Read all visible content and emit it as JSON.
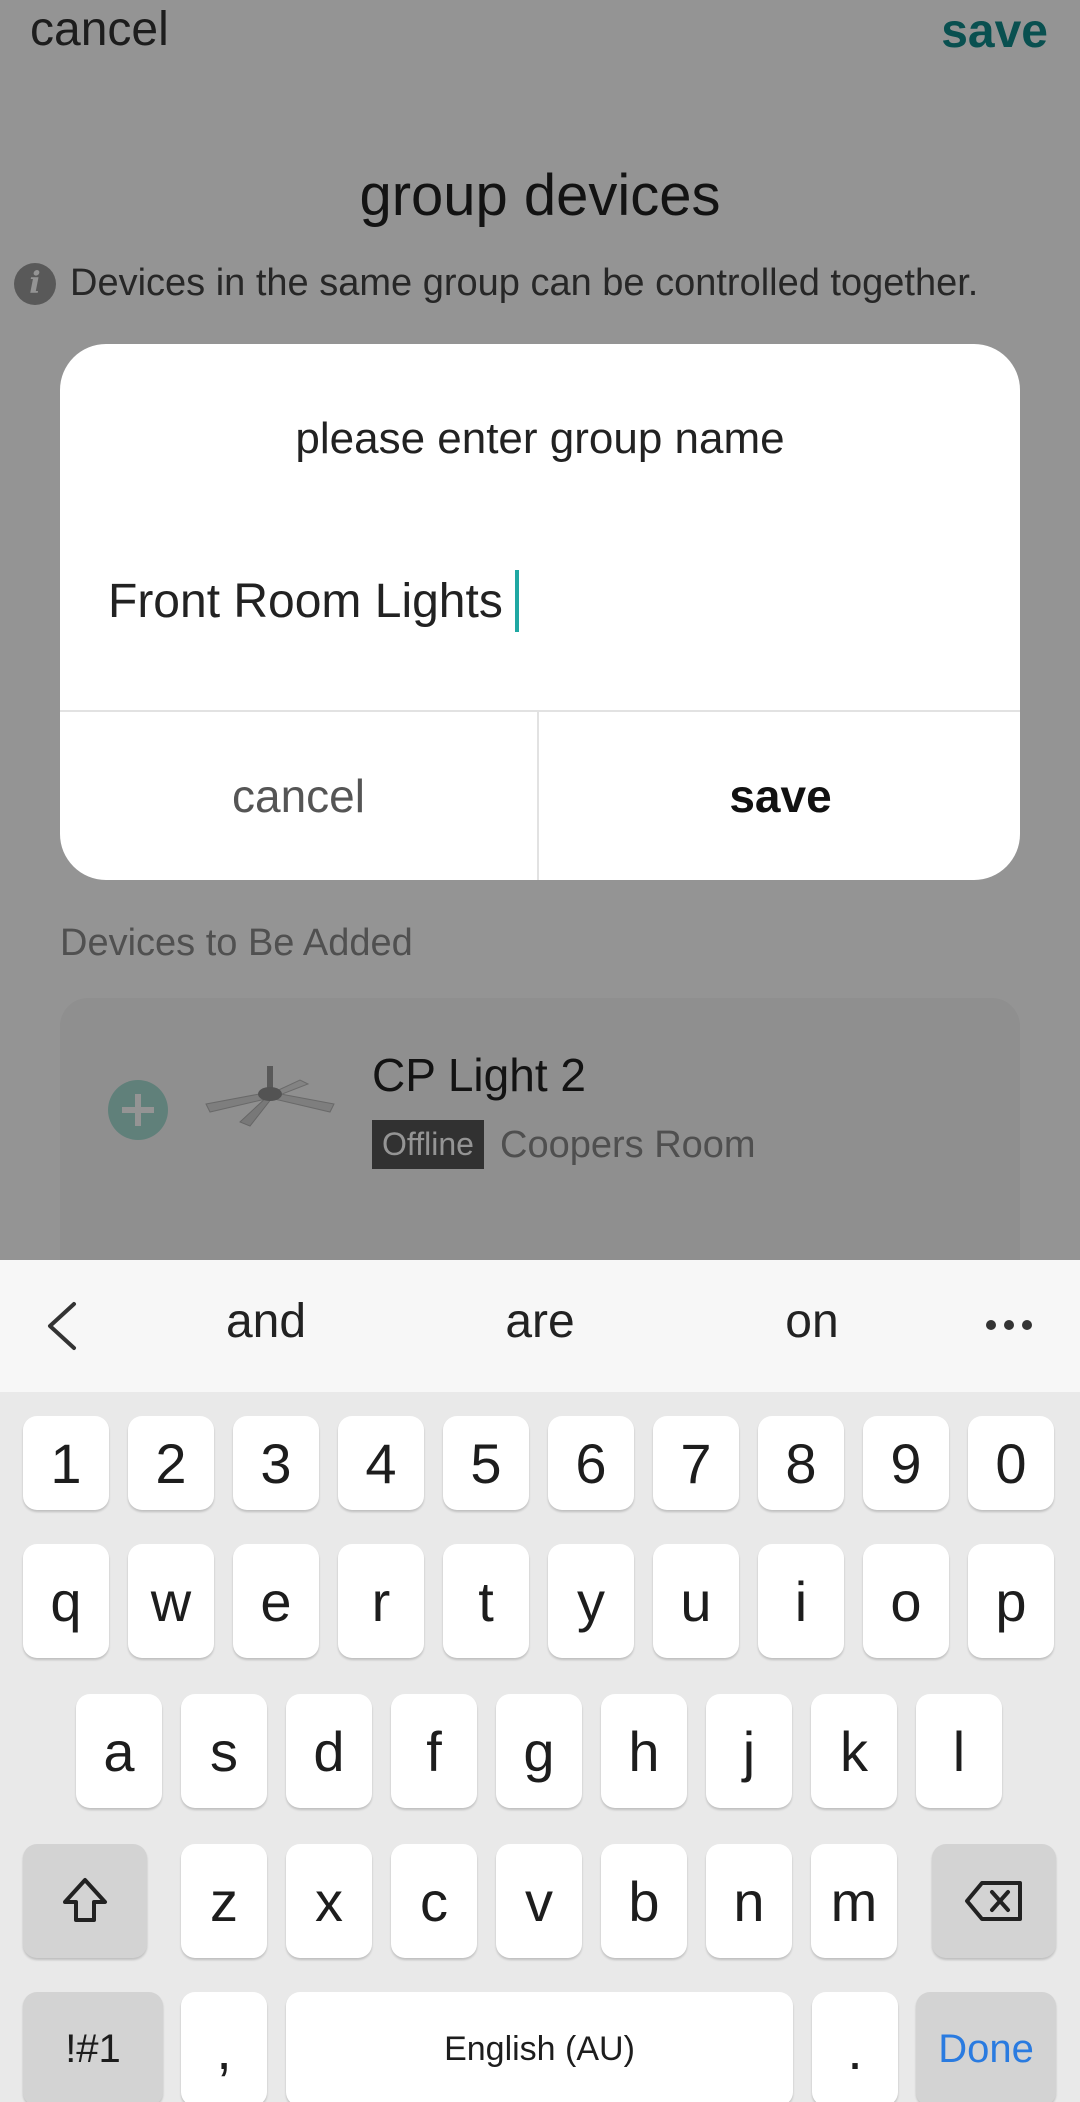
{
  "header": {
    "cancel_label": "cancel",
    "save_label": "save",
    "title": "group devices",
    "info_text": "Devices in the same group can be controlled together."
  },
  "dialog": {
    "title": "please enter group name",
    "input_value": "Front Room Lights",
    "cancel_label": "cancel",
    "save_label": "save"
  },
  "devices_section": {
    "label": "Devices to Be Added",
    "items": [
      {
        "name": "CP Light 2",
        "status": "Offline",
        "room": "Coopers Room"
      }
    ]
  },
  "keyboard": {
    "suggestions": [
      "and",
      "are",
      "on"
    ],
    "number_row": [
      "1",
      "2",
      "3",
      "4",
      "5",
      "6",
      "7",
      "8",
      "9",
      "0"
    ],
    "row1": [
      "q",
      "w",
      "e",
      "r",
      "t",
      "y",
      "u",
      "i",
      "o",
      "p"
    ],
    "row2": [
      "a",
      "s",
      "d",
      "f",
      "g",
      "h",
      "j",
      "k",
      "l"
    ],
    "row3": [
      "z",
      "x",
      "c",
      "v",
      "b",
      "n",
      "m"
    ],
    "symbols_label": "!#1",
    "comma_label": ",",
    "space_label": "English (AU)",
    "period_label": ".",
    "done_label": "Done"
  },
  "colors": {
    "accent": "#108a8a",
    "caret": "#1fa8a3",
    "done_key": "#2a7be0"
  }
}
